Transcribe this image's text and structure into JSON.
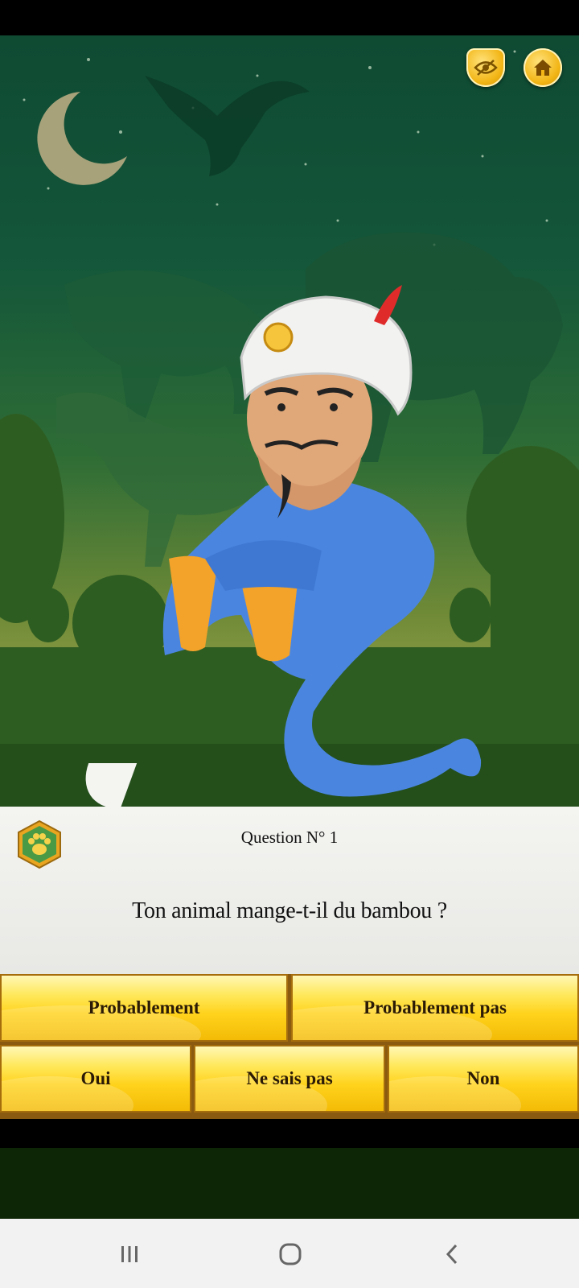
{
  "header": {
    "buttons": [
      {
        "name": "privacy-shield",
        "icon": "eye-slash-shield-icon"
      },
      {
        "name": "home",
        "icon": "home-icon"
      }
    ]
  },
  "question": {
    "number_label": "Question N° 1",
    "text": "Ton animal mange-t-il du bambou ?",
    "badge_icon": "paw-icon"
  },
  "answers": {
    "probably": "Probablement",
    "probably_not": "Probablement pas",
    "yes": "Oui",
    "dont_know": "Ne sais pas",
    "no": "Non"
  },
  "navigation": {
    "icons": [
      "recent-apps-icon",
      "home-circle-icon",
      "back-chevron-icon"
    ]
  },
  "colors": {
    "answer_gold": "#ffd21b",
    "sky_green": "#14573a",
    "genie_blue": "#4a86e0"
  }
}
